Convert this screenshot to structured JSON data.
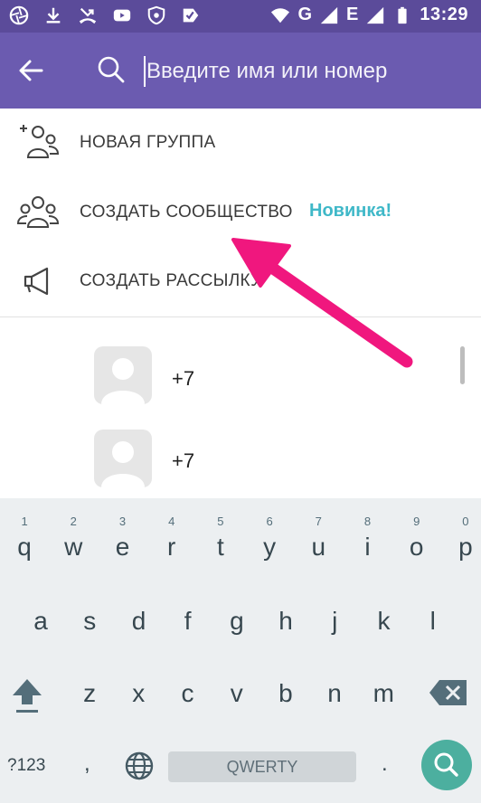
{
  "status_bar": {
    "time": "13:29",
    "network": "G",
    "network2": "E",
    "icons": [
      "aperture-icon",
      "download-icon",
      "missed-call-icon",
      "youtube-icon",
      "shield-app-icon",
      "check-app-icon",
      "wifi-icon",
      "signal-icon",
      "battery-icon"
    ]
  },
  "app_bar": {
    "color": "#6b5bb0",
    "search_placeholder": "Введите имя или номер"
  },
  "menu": [
    {
      "label": "НОВАЯ ГРУППА",
      "icon": "add-group-icon"
    },
    {
      "label": "СОЗДАТЬ СООБЩЕСТВО",
      "badge": "Новинка!",
      "icon": "community-icon"
    },
    {
      "label": "СОЗДАТЬ РАССЫЛКУ",
      "icon": "megaphone-icon"
    }
  ],
  "contacts": [
    {
      "number": "+7"
    },
    {
      "number": "+7"
    }
  ],
  "keyboard": {
    "row1": [
      "q",
      "w",
      "e",
      "r",
      "t",
      "y",
      "u",
      "i",
      "o",
      "p"
    ],
    "row1_hints": [
      "1",
      "2",
      "3",
      "4",
      "5",
      "6",
      "7",
      "8",
      "9",
      "0"
    ],
    "row2": [
      "a",
      "s",
      "d",
      "f",
      "g",
      "h",
      "j",
      "k",
      "l"
    ],
    "row3": [
      "z",
      "x",
      "c",
      "v",
      "b",
      "n",
      "m"
    ],
    "symbols_label": "?123",
    "comma": ",",
    "space_label": "QWERTY",
    "period": "."
  },
  "colors": {
    "status_bar": "#5b4b9a",
    "accent_badge": "#3fb8c8",
    "arrow": "#f0177e",
    "enter_key": "#4caf9f"
  }
}
